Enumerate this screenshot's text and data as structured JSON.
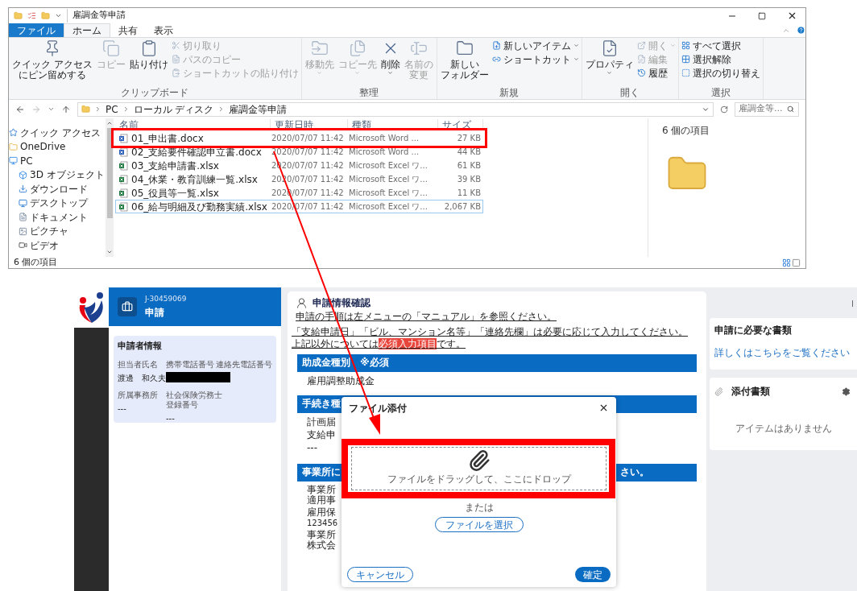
{
  "explorer": {
    "title": "雇調金等申請",
    "tabs": [
      {
        "label": "ファイル",
        "kind": "file",
        "selected": false
      },
      {
        "label": "ホーム",
        "kind": "tab",
        "selected": true
      },
      {
        "label": "共有",
        "kind": "tab",
        "selected": false
      },
      {
        "label": "表示",
        "kind": "tab",
        "selected": false
      }
    ],
    "ribbon_groups": [
      {
        "label": "クリップボード",
        "large": [
          {
            "lines": [
              "クイック アクセス",
              "にピン留めする"
            ],
            "disabled": false,
            "dropdown": false
          },
          {
            "lines": [
              "コピー"
            ],
            "disabled": true,
            "dropdown": false
          },
          {
            "lines": [
              "貼り付け"
            ],
            "disabled": false,
            "dropdown": false
          }
        ],
        "small": [
          {
            "label": "切り取り",
            "disabled": true,
            "dropdown": false
          },
          {
            "label": "パスのコピー",
            "disabled": true,
            "dropdown": false
          },
          {
            "label": "ショートカットの貼り付け",
            "disabled": true,
            "dropdown": false
          }
        ]
      },
      {
        "label": "整理",
        "large": [
          {
            "lines": [
              "移動先"
            ],
            "disabled": true,
            "dropdown": true
          },
          {
            "lines": [
              "コピー先"
            ],
            "disabled": true,
            "dropdown": true
          },
          {
            "lines": [
              "削除"
            ],
            "disabled": false,
            "dropdown": true
          },
          {
            "lines": [
              "名前の",
              "変更"
            ],
            "disabled": true,
            "dropdown": false
          }
        ]
      },
      {
        "label": "新規",
        "large": [
          {
            "lines": [
              "新しい",
              "フォルダー"
            ],
            "disabled": false,
            "dropdown": false
          }
        ],
        "small": [
          {
            "label": "新しいアイテム",
            "disabled": false,
            "dropdown": true
          },
          {
            "label": "ショートカット",
            "disabled": false,
            "dropdown": true
          }
        ]
      },
      {
        "label": "開く",
        "large": [
          {
            "lines": [
              "プロパティ"
            ],
            "disabled": false,
            "dropdown": true
          }
        ],
        "small": [
          {
            "label": "開く",
            "disabled": true,
            "dropdown": true
          },
          {
            "label": "編集",
            "disabled": true,
            "dropdown": false
          },
          {
            "label": "履歴",
            "disabled": false,
            "dropdown": false
          }
        ]
      },
      {
        "label": "選択",
        "small": [
          {
            "label": "すべて選択",
            "disabled": false,
            "dropdown": false
          },
          {
            "label": "選択解除",
            "disabled": false,
            "dropdown": false
          },
          {
            "label": "選択の切り替え",
            "disabled": false,
            "dropdown": false
          }
        ]
      }
    ],
    "breadcrumbs": [
      "PC",
      "ローカル ディスク",
      "雇調金等申請"
    ],
    "search": {
      "placeholder": "雇調金等..."
    },
    "nav": [
      {
        "label": "クイック アクセス",
        "kind": "star"
      },
      {
        "label": "OneDrive",
        "kind": "folder"
      },
      {
        "label": "PC",
        "kind": "pc",
        "children": [
          {
            "label": "3D オブジェクト",
            "kind": "objects"
          },
          {
            "label": "ダウンロード",
            "kind": "download"
          },
          {
            "label": "デスクトップ",
            "kind": "desktop"
          },
          {
            "label": "ドキュメント",
            "kind": "document"
          },
          {
            "label": "ピクチャ",
            "kind": "picture"
          },
          {
            "label": "ビデオ",
            "kind": "video"
          }
        ]
      }
    ],
    "columns": [
      "名前",
      "更新日時",
      "種類",
      "サイズ"
    ],
    "files": [
      {
        "name": "01_申出書.docx",
        "date": "2020/07/07 11:42",
        "type": "Microsoft Word ...",
        "size": "27 KB",
        "kind": "word",
        "focused": false
      },
      {
        "name": "02_支給要件確認申立書.docx",
        "date": "2020/07/07 11:42",
        "type": "Microsoft Word ...",
        "size": "44 KB",
        "kind": "word",
        "focused": false
      },
      {
        "name": "03_支給申請書.xlsx",
        "date": "2020/07/07 11:42",
        "type": "Microsoft Excel ワ...",
        "size": "61 KB",
        "kind": "excel",
        "focused": false
      },
      {
        "name": "04_休業・教育訓練一覧.xlsx",
        "date": "2020/07/07 11:42",
        "type": "Microsoft Excel ワ...",
        "size": "39 KB",
        "kind": "excel",
        "focused": false
      },
      {
        "name": "05_役員等一覧.xlsx",
        "date": "2020/07/07 11:42",
        "type": "Microsoft Excel ワ...",
        "size": "11 KB",
        "kind": "excel",
        "focused": false
      },
      {
        "name": "06_給与明細及び勤務実績.xlsx",
        "date": "2020/07/07 11:42",
        "type": "Microsoft Excel ワ...",
        "size": "2,067 KB",
        "kind": "excel",
        "focused": true
      }
    ],
    "details": "6 個の項目",
    "status": "6 個の項目"
  },
  "webapp": {
    "case": {
      "number": "J-30459069",
      "title": "申請"
    },
    "applicant": {
      "title": "申請者情報",
      "fields": [
        {
          "lines": [
            "担当者氏名"
          ],
          "value": "渡邊　和久夫",
          "redacted": false
        },
        {
          "lines": [
            "携帯電話番号"
          ],
          "redacted": true
        },
        {
          "lines": [
            "連絡先電話番号"
          ],
          "redacted": false
        },
        {
          "lines": [
            "所属事務所"
          ],
          "value": "---",
          "redacted": false
        },
        {
          "lines": [
            "社会保険労務士",
            "登録番号"
          ],
          "value": "---",
          "redacted": false
        }
      ]
    },
    "main": {
      "title": "申請情報確認",
      "note": "申請の手順は左メニューの「マニュアル」を参照ください。",
      "note2": "「支給申請日」「ビル、マンション名等」「連絡先欄」は必要に応じて入力してください。",
      "note3": {
        "before": "上記以外については",
        "highlight": "必須入力項目",
        "after": "です。"
      },
      "sections": [
        {
          "title": "助成金種別　※必須",
          "items": [
            "雇用調整助成金"
          ]
        },
        {
          "title": "手続き種",
          "items": [
            "計画届",
            "支給申",
            "---"
          ]
        },
        {
          "title": "事業所に",
          "title_end": "さい。",
          "items": [
            "事業所",
            "適用事",
            "雇用保",
            "123456",
            "事業所",
            "株式会"
          ]
        }
      ]
    },
    "dialog": {
      "title": "ファイル添付",
      "drop_text": "ファイルをドラッグして、ここにドロップ",
      "or": "または",
      "select": "ファイルを選択",
      "cancel": "キャンセル",
      "ok": "確定"
    },
    "required_docs": {
      "title": "申請に必要な書類",
      "link": "詳しくはこちらをご覧ください"
    },
    "attachments": {
      "title": "添付書類",
      "empty": "アイテムはありません"
    }
  }
}
